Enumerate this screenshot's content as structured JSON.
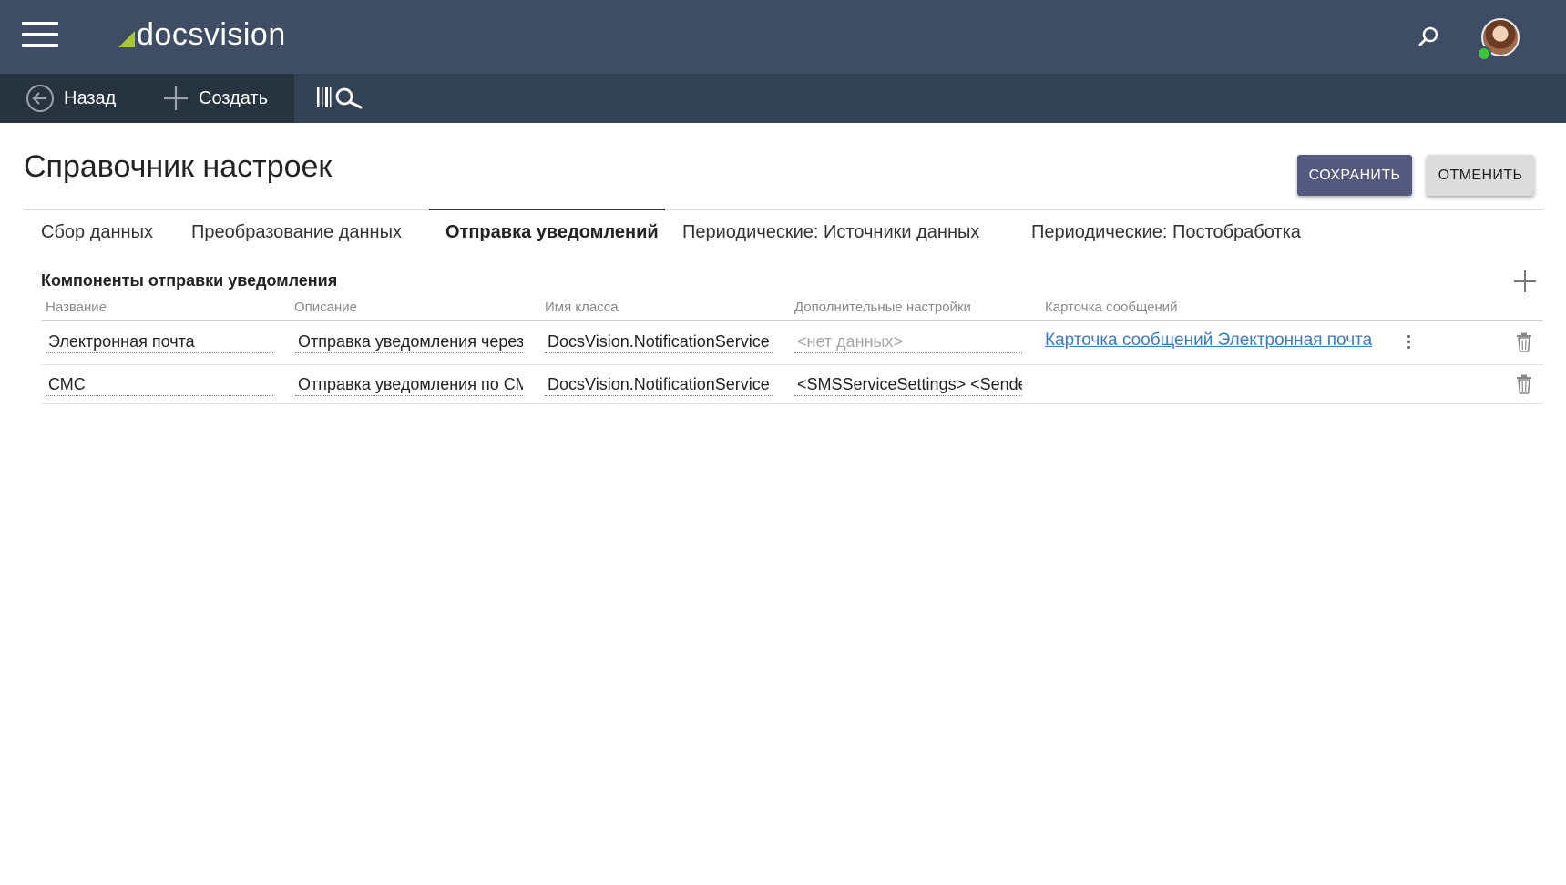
{
  "header": {
    "logo_text": "docsvision",
    "brand_accent": "#a7c638",
    "bar_color": "#3e4d64"
  },
  "toolbar": {
    "back_label": "Назад",
    "create_label": "Создать"
  },
  "page": {
    "title": "Справочник настроек",
    "save_label": "СОХРАНИТЬ",
    "cancel_label": "ОТМЕНИТЬ"
  },
  "tabs": [
    {
      "label": "Сбор данных",
      "active": false
    },
    {
      "label": "Преобразование данных",
      "active": false
    },
    {
      "label": "Отправка уведомлений",
      "active": true
    },
    {
      "label": "Периодические: Источники данных",
      "active": false
    },
    {
      "label": "Периодические: Постобработка",
      "active": false
    }
  ],
  "section": {
    "title": "Компоненты отправки уведомления",
    "columns": [
      "Название",
      "Описание",
      "Имя класса",
      "Дополнительные настройки",
      "Карточка сообщений"
    ],
    "rows": [
      {
        "name": "Электронная почта",
        "description": "Отправка уведомления через",
        "class_name": "DocsVision.NotificationService",
        "extra_settings": "<нет данных>",
        "message_card": "Карточка сообщений Электронная почта"
      },
      {
        "name": "СМС",
        "description": "Отправка уведомления по СМС",
        "class_name": "DocsVision.NotificationService",
        "extra_settings": "<SMSServiceSettings>   <Sender",
        "message_card": ""
      }
    ]
  },
  "icons": {
    "menu": "hamburger-menu-icon",
    "search": "search-icon",
    "back": "back-arrow-icon",
    "create": "plus-icon",
    "barcode": "barcode-search-icon",
    "add": "plus-icon",
    "more": "kebab-menu-icon",
    "delete": "trash-icon"
  }
}
